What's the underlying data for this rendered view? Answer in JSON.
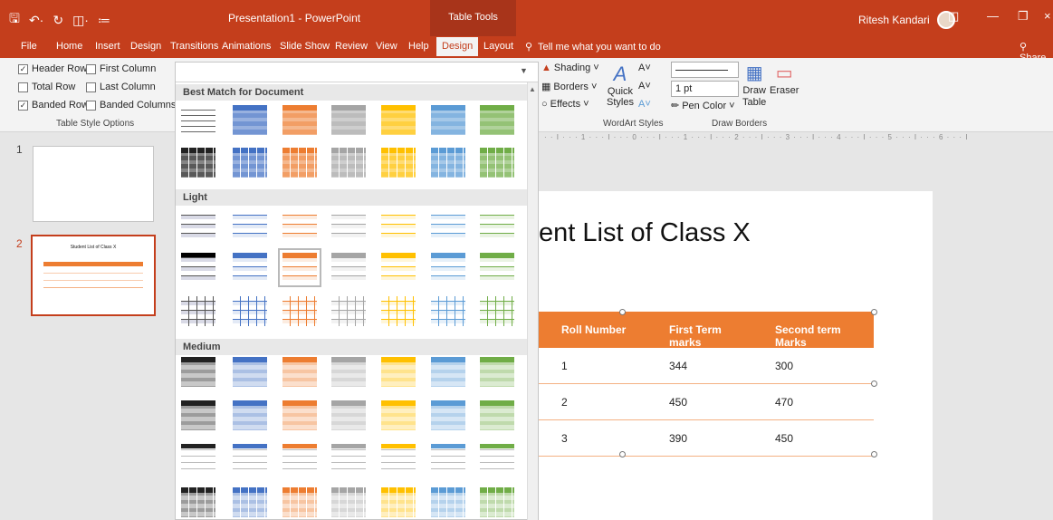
{
  "title_bar": {
    "doc_title": "Presentation1  -  PowerPoint",
    "context_tab_header": "Table Tools",
    "user_name": "Ritesh Kandari"
  },
  "tabs": [
    "File",
    "Home",
    "Insert",
    "Design",
    "Transitions",
    "Animations",
    "Slide Show",
    "Review",
    "View",
    "Help",
    "Design",
    "Layout"
  ],
  "active_tab_index": 10,
  "tell_me": "Tell me what you want to do",
  "share": "Share",
  "table_style_options": {
    "header_row": "Header Row",
    "first_column": "First Column",
    "total_row": "Total Row",
    "last_column": "Last Column",
    "banded_rows": "Banded Rows",
    "banded_columns": "Banded Columns",
    "group_label": "Table Style Options"
  },
  "wordart": {
    "shading": "Shading",
    "borders": "Borders",
    "effects": "Effects",
    "quick_styles_1": "Quick",
    "quick_styles_2": "Styles",
    "group_label": "WordArt Styles"
  },
  "draw_borders": {
    "pen_weight": "1 pt",
    "pen_color": "Pen Color",
    "draw_table_1": "Draw",
    "draw_table_2": "Table",
    "eraser": "Eraser",
    "group_label": "Draw Borders"
  },
  "gallery": {
    "sec_best": "Best Match for Document",
    "sec_light": "Light",
    "sec_medium": "Medium"
  },
  "ruler_text": "· · I · · · 1 · · · I · · · 0 · · · I · · · 1 · · · I · · · 2 · · · I · · · 3 · · · I · · · 4 · · · I · · · 5 · · · I · · · 6 · · · I",
  "slides": [
    {
      "number": "1"
    },
    {
      "number": "2",
      "title": "Student List of Class X"
    }
  ],
  "slide": {
    "title_visible": "ent List of Class X",
    "table": {
      "headers": [
        "Roll Number",
        "First Term marks",
        "Second term Marks"
      ],
      "rows": [
        [
          "1",
          "344",
          "300"
        ],
        [
          "2",
          "450",
          "470"
        ],
        [
          "3",
          "390",
          "450"
        ]
      ]
    }
  },
  "colors": {
    "accent": "#c43e1c",
    "table_header": "#ed7d31",
    "palette": [
      "#222222",
      "#4472c4",
      "#ed7d31",
      "#a5a5a5",
      "#ffc000",
      "#5b9bd5",
      "#70ad47"
    ]
  }
}
